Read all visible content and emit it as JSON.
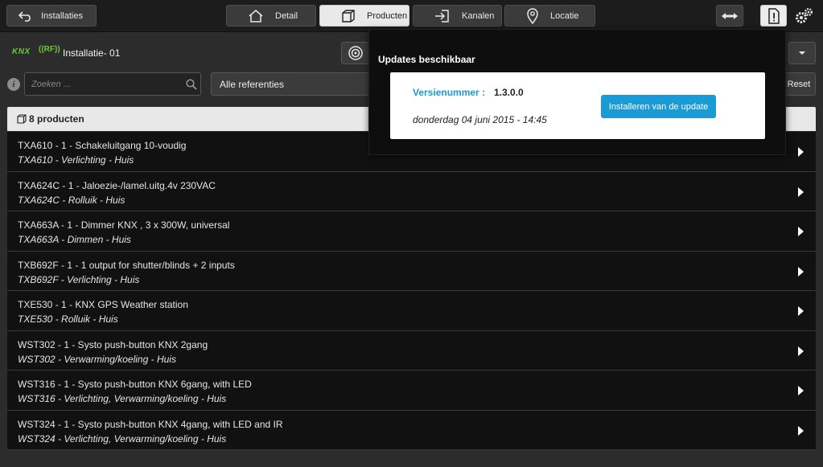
{
  "topbar": {
    "back_label": "Installaties",
    "tabs": [
      {
        "label": "Detail",
        "active": false
      },
      {
        "label": "Producten",
        "active": true
      },
      {
        "label": "Kanalen",
        "active": false
      },
      {
        "label": "Locatie",
        "active": false
      }
    ],
    "icons": [
      "arrows-icon",
      "alert-document-icon",
      "gears-icon"
    ]
  },
  "installation": {
    "knx_logo": "KNX",
    "rf_logo": "((RF))",
    "name": "Installatie- 01"
  },
  "filters": {
    "search_placeholder": "Zoeken ...",
    "reference_select": "Alle referenties",
    "reset_label": "Reset"
  },
  "list": {
    "header": "8 producten",
    "items": [
      {
        "line1": "TXA610 - 1 - Schakeluitgang 10-voudig",
        "line2": "TXA610 - Verlichting - Huis"
      },
      {
        "line1": "TXA624C - 1 - Jaloezie-/lamel.uitg.4v 230VAC",
        "line2": "TXA624C - Rolluik - Huis"
      },
      {
        "line1": "TXA663A - 1 - Dimmer KNX , 3 x 300W, universal",
        "line2": "TXA663A - Dimmen - Huis"
      },
      {
        "line1": "TXB692F - 1 - 1 output for shutter/blinds + 2 inputs",
        "line2": "TXB692F - Verlichting - Huis"
      },
      {
        "line1": "TXE530 - 1 - KNX GPS Weather station",
        "line2": "TXE530 - Rolluik - Huis"
      },
      {
        "line1": "WST302 - 1 - Systo push-button KNX 2gang",
        "line2": "WST302 - Verwarming/koeling - Huis"
      },
      {
        "line1": "WST316 - 1 - Systo push-button KNX 6gang, with LED",
        "line2": "WST316 - Verlichting, Verwarming/koeling - Huis"
      },
      {
        "line1": "WST324 - 1 - Systo push-button KNX 4gang, with LED and IR",
        "line2": "WST324 - Verlichting, Verwarming/koeling - Huis"
      }
    ]
  },
  "popup": {
    "title": "Updates beschikbaar",
    "version_label": "Versienummer :",
    "version_value": "1.3.0.0",
    "date": "donderdag 04 juni 2015 - 14:45",
    "install_button": "Installeren van de update"
  },
  "colors": {
    "accent": "#1b9ad6",
    "knx_green": "#6bc83a",
    "background": "#2c2c2c",
    "row_bg": "#111111"
  }
}
